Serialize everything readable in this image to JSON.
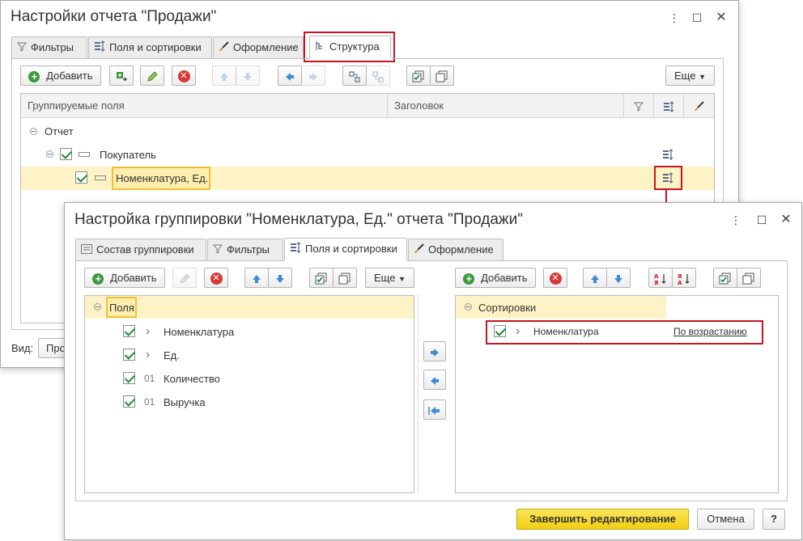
{
  "back_window": {
    "title": "Настройки отчета \"Продажи\"",
    "tabs": [
      {
        "label": "Фильтры",
        "icon": "filter-icon"
      },
      {
        "label": "Поля и сортировки",
        "icon": "sort-fields-icon"
      },
      {
        "label": "Оформление",
        "icon": "brush-icon"
      },
      {
        "label": "Структура",
        "icon": "structure-icon",
        "active": true
      }
    ],
    "toolbar": {
      "add_label": "Добавить",
      "more_label": "Еще"
    },
    "columns": {
      "grouped_fields": "Группируемые поля",
      "header": "Заголовок"
    },
    "tree": [
      {
        "label": "Отчет",
        "level": 0
      },
      {
        "label": "Покупатель",
        "level": 1,
        "checked": true
      },
      {
        "label": "Номенклатура, Ед.",
        "level": 2,
        "checked": true,
        "selected": true
      }
    ],
    "view_label": "Вид:",
    "view_button_partial": "Про"
  },
  "front_window": {
    "title": "Настройка группировки \"Номенклатура, Ед.\" отчета \"Продажи\"",
    "tabs": [
      {
        "label": "Состав группировки",
        "icon": "list-icon"
      },
      {
        "label": "Фильтры",
        "icon": "filter-icon"
      },
      {
        "label": "Поля и сортировки",
        "icon": "sort-fields-icon",
        "active": true
      },
      {
        "label": "Оформление",
        "icon": "brush-icon"
      }
    ],
    "left_panel": {
      "add_label": "Добавить",
      "more_label": "Еще",
      "root_label": "Поля",
      "items": [
        {
          "prefix": "›",
          "label": "Номенклатура",
          "checked": true
        },
        {
          "prefix": "›",
          "label": "Ед.",
          "checked": true
        },
        {
          "prefix": "01",
          "label": "Количество",
          "checked": true
        },
        {
          "prefix": "01",
          "label": "Выручка",
          "checked": true
        }
      ]
    },
    "right_panel": {
      "add_label": "Добавить",
      "root_label": "Сортировки",
      "items": [
        {
          "prefix": "›",
          "label": "Номенклатура",
          "direction": "По возрастанию",
          "checked": true
        }
      ]
    },
    "finish_label": "Завершить редактирование",
    "cancel_label": "Отмена",
    "help_label": "?"
  },
  "colors": {
    "highlight": "#fdf3c6",
    "callout_red": "#c8141e",
    "primary_button": "#f5d626",
    "check_green": "#1e8a3c"
  }
}
